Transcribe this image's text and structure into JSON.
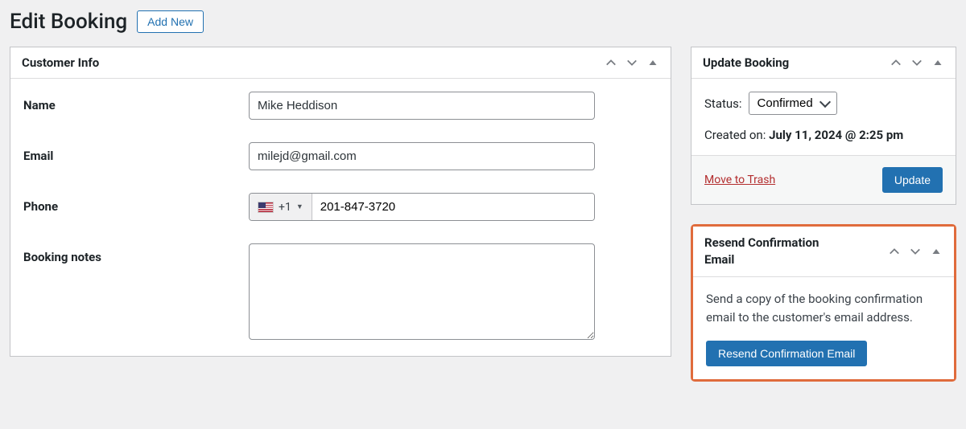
{
  "header": {
    "title": "Edit Booking",
    "add_new_label": "Add New"
  },
  "customer_info": {
    "panel_title": "Customer Info",
    "name_label": "Name",
    "name_value": "Mike Heddison",
    "email_label": "Email",
    "email_value": "milejd@gmail.com",
    "phone_label": "Phone",
    "phone_country_code": "+1",
    "phone_value": "201-847-3720",
    "notes_label": "Booking notes",
    "notes_value": ""
  },
  "update_booking": {
    "panel_title": "Update Booking",
    "status_label": "Status:",
    "status_value": "Confirmed",
    "created_label": "Created on:",
    "created_value": "July 11, 2024 @ 2:25 pm",
    "trash_label": "Move to Trash",
    "update_button_label": "Update"
  },
  "resend": {
    "panel_title": "Resend Confirmation Email",
    "description": "Send a copy of the booking confirmation email to the customer's email address.",
    "button_label": "Resend Confirmation Email"
  }
}
